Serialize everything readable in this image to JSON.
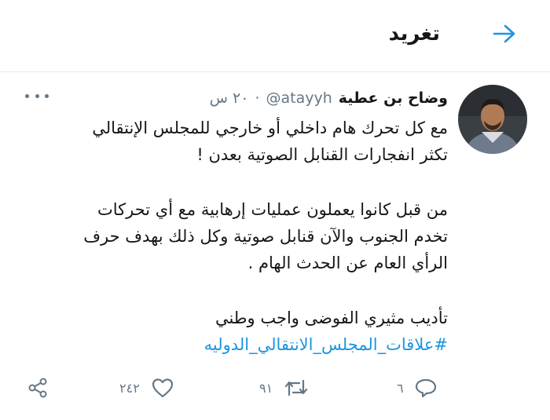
{
  "header": {
    "title": "تغريد"
  },
  "tweet": {
    "author_name": "وضاح بن عطية",
    "handle": "@atayyh",
    "separator": "·",
    "time": "٢٠ س",
    "lines": [
      "مع كل تحرك هام داخلي أو خارجي للمجلس الإنتقالي",
      "تكثر انفجارات القنابل الصوتية بعدن !",
      "من قبل كانوا يعملون عمليات إرهابية مع أي تحركات",
      "تخدم الجنوب والآن قنابل صوتية وكل ذلك بهدف حرف",
      "الرأي العام عن الحدث الهام .",
      "تأديب مثيري الفوضى واجب وطني"
    ],
    "hashtag": "#علاقات_المجلس_الانتقالي_الدوليه"
  },
  "actions": {
    "reply_count": "٦",
    "retweet_count": "٩١",
    "like_count": "٢٤٢"
  },
  "colors": {
    "accent": "#1b95e0",
    "muted": "#657786",
    "text": "#14171a",
    "divider": "#e6ecf0"
  },
  "icons": [
    "arrow-right-icon",
    "more-icon",
    "reply-icon",
    "retweet-icon",
    "like-icon",
    "share-icon"
  ]
}
